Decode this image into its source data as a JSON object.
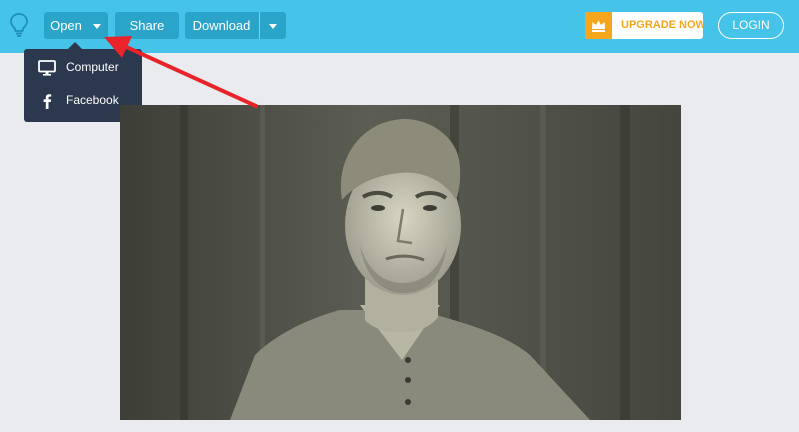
{
  "toolbar": {
    "open_label": "Open",
    "share_label": "Share",
    "download_label": "Download",
    "upgrade_label": "UPGRADE NOW",
    "login_label": "LOGIN",
    "logo_icon": "lightbulb-icon",
    "crown_icon": "crown-icon"
  },
  "open_menu": {
    "items": [
      {
        "label": "Computer",
        "icon": "monitor-icon"
      },
      {
        "label": "Facebook",
        "icon": "facebook-icon"
      }
    ]
  },
  "colors": {
    "topbar": "#45c3e8",
    "button": "#2aa4c9",
    "menu": "#2b384d",
    "upgrade_accent": "#f5a61c",
    "canvas_bg": "#e9ebee",
    "annotation_arrow": "#e8232a"
  }
}
